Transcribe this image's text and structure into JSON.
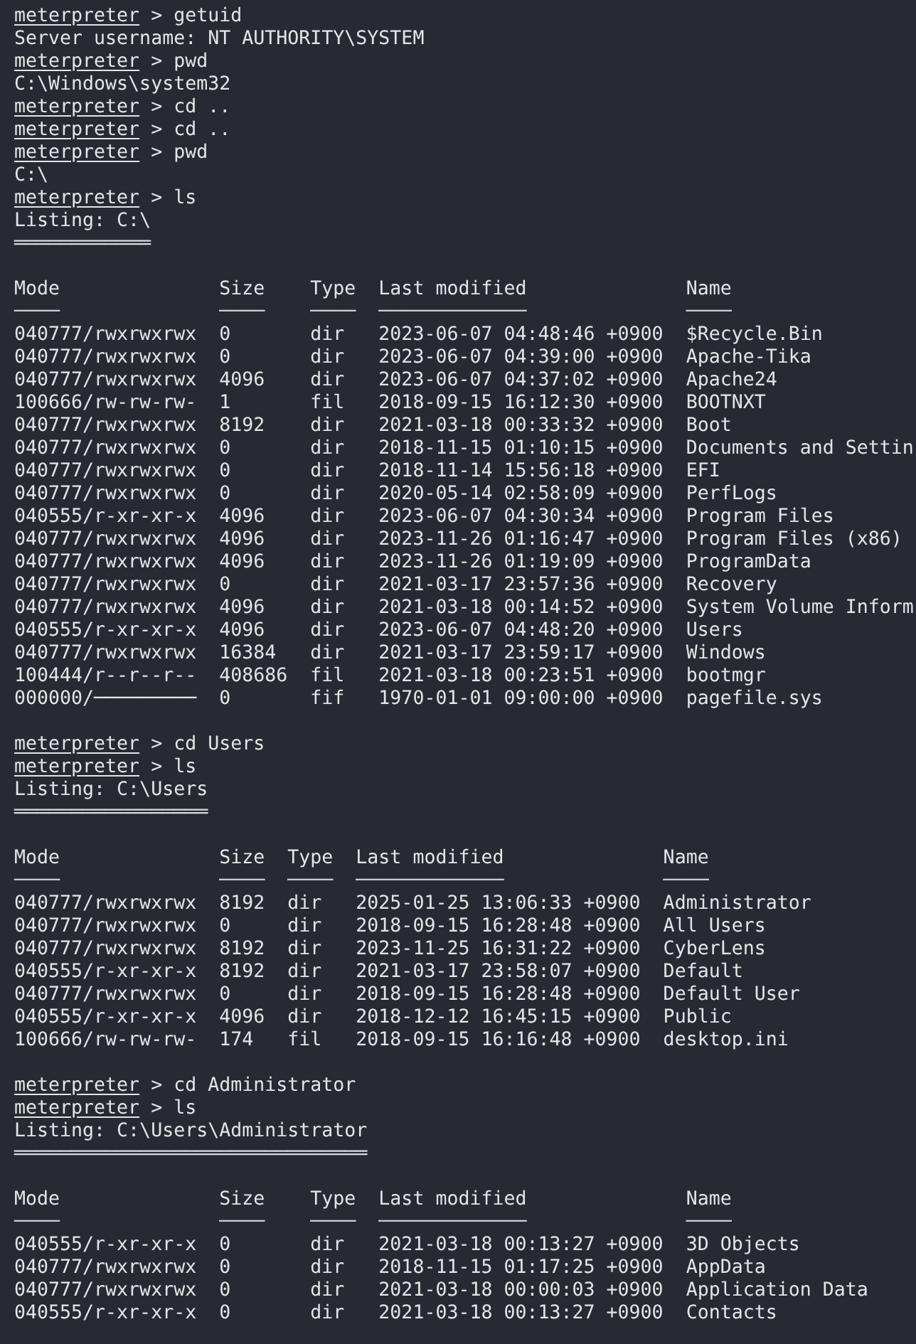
{
  "terminal": {
    "lines": [
      {
        "kind": "command",
        "prompt": "meterpreter",
        "command": "> getuid"
      },
      {
        "kind": "output",
        "text": "Server username: NT AUTHORITY\\SYSTEM"
      },
      {
        "kind": "command",
        "prompt": "meterpreter",
        "command": "> pwd"
      },
      {
        "kind": "output",
        "text": "C:\\Windows\\system32"
      },
      {
        "kind": "command",
        "prompt": "meterpreter",
        "command": "> cd .."
      },
      {
        "kind": "command",
        "prompt": "meterpreter",
        "command": "> cd .."
      },
      {
        "kind": "command",
        "prompt": "meterpreter",
        "command": "> pwd"
      },
      {
        "kind": "output",
        "text": "C:\\"
      },
      {
        "kind": "command",
        "prompt": "meterpreter",
        "command": "> ls"
      },
      {
        "kind": "output",
        "text": "Listing: C:\\"
      },
      {
        "kind": "rule",
        "text": "════════════"
      },
      {
        "kind": "blank"
      },
      {
        "kind": "header",
        "text": "Mode              Size    Type  Last modified              Name"
      },
      {
        "kind": "dashes",
        "text": "────              ────    ────  ─────────────              ────"
      },
      {
        "kind": "row",
        "text": "040777/rwxrwxrwx  0       dir   2023-06-07 04:48:46 +0900  $Recycle.Bin"
      },
      {
        "kind": "row",
        "text": "040777/rwxrwxrwx  0       dir   2023-06-07 04:39:00 +0900  Apache-Tika"
      },
      {
        "kind": "row",
        "text": "040777/rwxrwxrwx  4096    dir   2023-06-07 04:37:02 +0900  Apache24"
      },
      {
        "kind": "row",
        "text": "100666/rw-rw-rw-  1       fil   2018-09-15 16:12:30 +0900  BOOTNXT"
      },
      {
        "kind": "row",
        "text": "040777/rwxrwxrwx  8192    dir   2021-03-18 00:33:32 +0900  Boot"
      },
      {
        "kind": "row",
        "text": "040777/rwxrwxrwx  0       dir   2018-11-15 01:10:15 +0900  Documents and Settin"
      },
      {
        "kind": "row",
        "text": "040777/rwxrwxrwx  0       dir   2018-11-14 15:56:18 +0900  EFI"
      },
      {
        "kind": "row",
        "text": "040777/rwxrwxrwx  0       dir   2020-05-14 02:58:09 +0900  PerfLogs"
      },
      {
        "kind": "row",
        "text": "040555/r-xr-xr-x  4096    dir   2023-06-07 04:30:34 +0900  Program Files"
      },
      {
        "kind": "row",
        "text": "040777/rwxrwxrwx  4096    dir   2023-11-26 01:16:47 +0900  Program Files (x86)"
      },
      {
        "kind": "row",
        "text": "040777/rwxrwxrwx  4096    dir   2023-11-26 01:19:09 +0900  ProgramData"
      },
      {
        "kind": "row",
        "text": "040777/rwxrwxrwx  0       dir   2021-03-17 23:57:36 +0900  Recovery"
      },
      {
        "kind": "row",
        "text": "040777/rwxrwxrwx  4096    dir   2021-03-18 00:14:52 +0900  System Volume Inform"
      },
      {
        "kind": "row",
        "text": "040555/r-xr-xr-x  4096    dir   2023-06-07 04:48:20 +0900  Users"
      },
      {
        "kind": "row",
        "text": "040777/rwxrwxrwx  16384   dir   2021-03-17 23:59:17 +0900  Windows"
      },
      {
        "kind": "row",
        "text": "100444/r--r--r--  408686  fil   2021-03-18 00:23:51 +0900  bootmgr"
      },
      {
        "kind": "row",
        "text": "000000/─────────  0       fif   1970-01-01 09:00:00 +0900  pagefile.sys"
      },
      {
        "kind": "blank"
      },
      {
        "kind": "command",
        "prompt": "meterpreter",
        "command": "> cd Users"
      },
      {
        "kind": "command",
        "prompt": "meterpreter",
        "command": "> ls"
      },
      {
        "kind": "output",
        "text": "Listing: C:\\Users"
      },
      {
        "kind": "rule",
        "text": "═════════════════"
      },
      {
        "kind": "blank"
      },
      {
        "kind": "header",
        "text": "Mode              Size  Type  Last modified              Name"
      },
      {
        "kind": "dashes",
        "text": "────              ────  ────  ─────────────              ────"
      },
      {
        "kind": "row",
        "text": "040777/rwxrwxrwx  8192  dir   2025-01-25 13:06:33 +0900  Administrator"
      },
      {
        "kind": "row",
        "text": "040777/rwxrwxrwx  0     dir   2018-09-15 16:28:48 +0900  All Users"
      },
      {
        "kind": "row",
        "text": "040777/rwxrwxrwx  8192  dir   2023-11-25 16:31:22 +0900  CyberLens"
      },
      {
        "kind": "row",
        "text": "040555/r-xr-xr-x  8192  dir   2021-03-17 23:58:07 +0900  Default"
      },
      {
        "kind": "row",
        "text": "040777/rwxrwxrwx  0     dir   2018-09-15 16:28:48 +0900  Default User"
      },
      {
        "kind": "row",
        "text": "040555/r-xr-xr-x  4096  dir   2018-12-12 16:45:15 +0900  Public"
      },
      {
        "kind": "row",
        "text": "100666/rw-rw-rw-  174   fil   2018-09-15 16:16:48 +0900  desktop.ini"
      },
      {
        "kind": "blank"
      },
      {
        "kind": "command",
        "prompt": "meterpreter",
        "command": "> cd Administrator"
      },
      {
        "kind": "command",
        "prompt": "meterpreter",
        "command": "> ls"
      },
      {
        "kind": "output",
        "text": "Listing: C:\\Users\\Administrator"
      },
      {
        "kind": "rule",
        "text": "═══════════════════════════════"
      },
      {
        "kind": "blank"
      },
      {
        "kind": "header",
        "text": "Mode              Size    Type  Last modified              Name"
      },
      {
        "kind": "dashes",
        "text": "────              ────    ────  ─────────────              ────"
      },
      {
        "kind": "row",
        "text": "040555/r-xr-xr-x  0       dir   2021-03-18 00:13:27 +0900  3D Objects"
      },
      {
        "kind": "row",
        "text": "040777/rwxrwxrwx  0       dir   2018-11-15 01:17:25 +0900  AppData"
      },
      {
        "kind": "row",
        "text": "040777/rwxrwxrwx  0       dir   2021-03-18 00:00:03 +0900  Application Data"
      },
      {
        "kind": "row",
        "text": "040555/r-xr-xr-x  0       dir   2021-03-18 00:13:27 +0900  Contacts"
      }
    ]
  }
}
